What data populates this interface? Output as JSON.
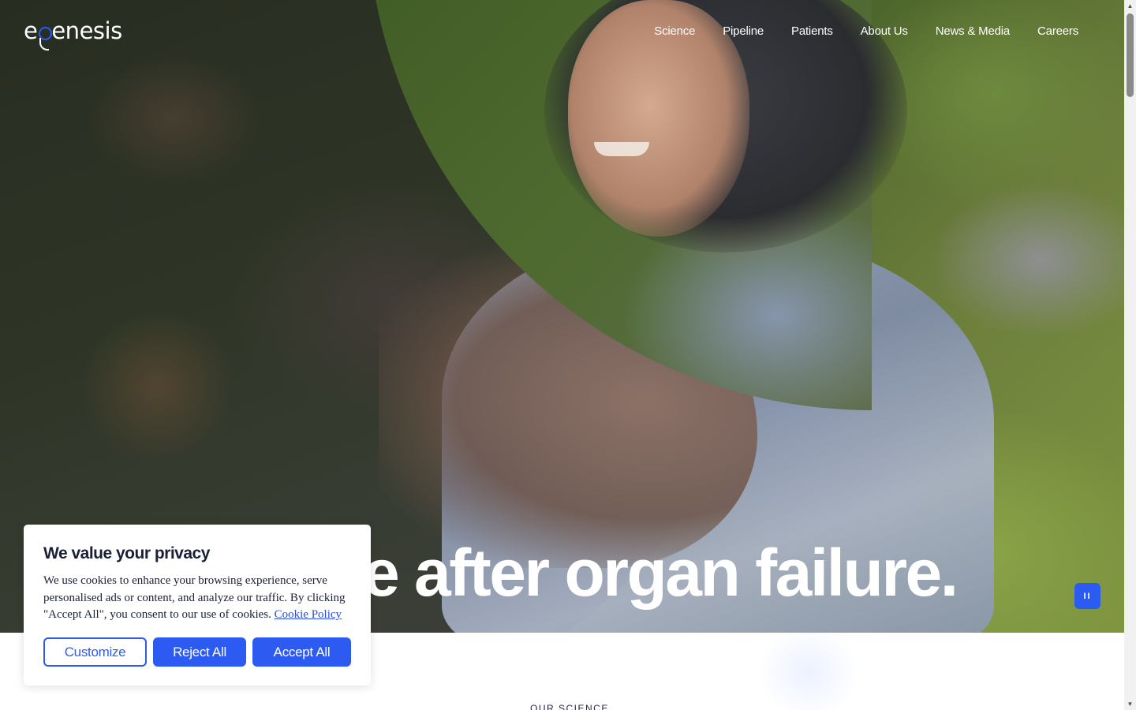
{
  "brand": {
    "name_part1": "e",
    "name_part2": "enesis",
    "accent_color": "#2d5af0"
  },
  "nav": {
    "items": [
      {
        "label": "Science"
      },
      {
        "label": "Pipeline"
      },
      {
        "label": "Patients"
      },
      {
        "label": "About Us"
      },
      {
        "label": "News & Media"
      },
      {
        "label": "Careers"
      }
    ]
  },
  "hero": {
    "headline": "e after organ failure.",
    "pause_icon": "pause-icon",
    "pause_label": "II"
  },
  "section": {
    "label": "OUR SCIENCE"
  },
  "cookie_banner": {
    "title": "We value your privacy",
    "text": "We use cookies to enhance your browsing experience, serve personalised ads or content, and analyze our traffic. By clicking \"Accept All\", you consent to our use of cookies.",
    "link_text": "Cookie Policy",
    "customize_label": "Customize",
    "reject_label": "Reject All",
    "accept_label": "Accept All"
  },
  "scrollbar": {
    "up_icon": "▲",
    "down_icon": "▼"
  }
}
